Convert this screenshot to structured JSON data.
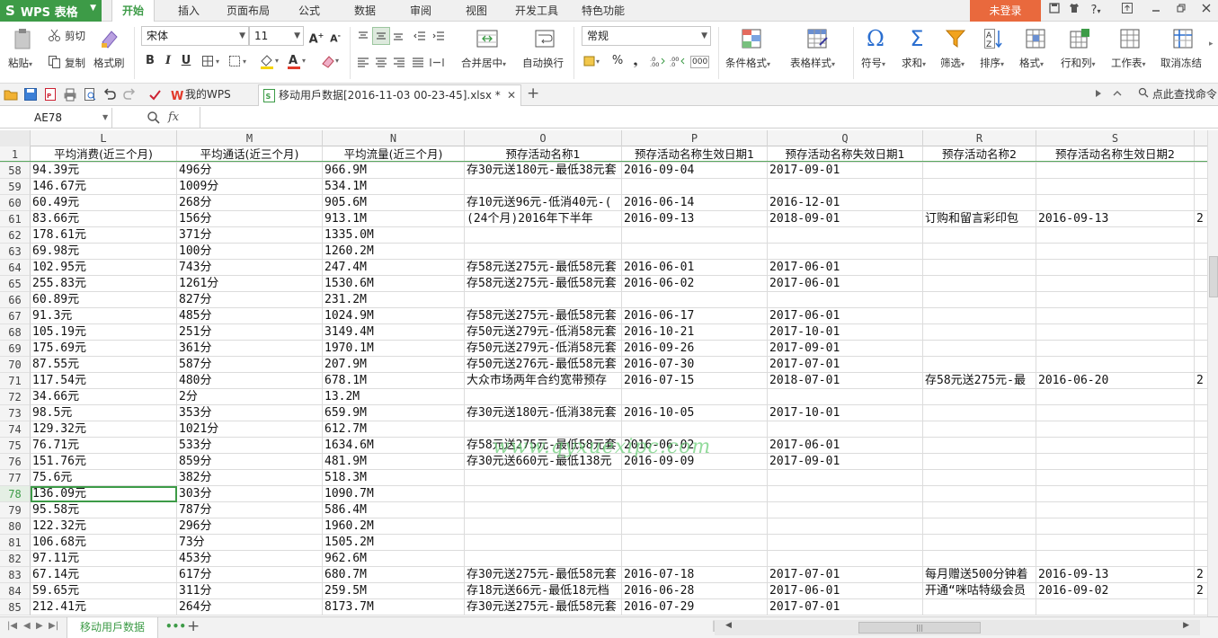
{
  "app": {
    "name": "WPS 表格",
    "login_label": "未登录",
    "help_label": "?"
  },
  "menu": {
    "tabs": [
      "开始",
      "插入",
      "页面布局",
      "公式",
      "数据",
      "审阅",
      "视图",
      "开发工具",
      "特色功能"
    ],
    "active": 0
  },
  "ribbon": {
    "paste": "粘贴",
    "cut": "剪切",
    "copy": "复制",
    "format_painter": "格式刷",
    "font_name": "宋体",
    "font_size": "11",
    "merge_center": "合并居中",
    "wrap_text": "自动换行",
    "number_format": "常规",
    "conditional_format": "条件格式",
    "table_style": "表格样式",
    "symbol": "符号",
    "sum": "求和",
    "filter": "筛选",
    "sort": "排序",
    "format": "格式",
    "rows_cols": "行和列",
    "worksheet": "工作表",
    "freeze": "取消冻结",
    "bold": "B",
    "italic": "I",
    "underline": "U",
    "percent": "%",
    "thousands": "000"
  },
  "tabs": {
    "my_wps": "我的WPS",
    "document": "移动用戶数据[2016-11-03 00-23-45].xlsx *",
    "find_command": "点此查找命令"
  },
  "formula_bar": {
    "name_box": "AE78",
    "fx": "fx",
    "content": ""
  },
  "grid": {
    "columns": [
      "L",
      "M",
      "N",
      "O",
      "P",
      "Q",
      "R",
      "S"
    ],
    "header_row_num": "1",
    "headers": [
      "平均消费(近三个月)",
      "平均通话(近三个月)",
      "平均流量(近三个月)",
      "预存活动名称1",
      "预存活动名称生效日期1",
      "预存活动名称失效日期1",
      "预存活动名称2",
      "预存活动名称生效日期2"
    ],
    "selected_row": "78",
    "overflow_char": "2",
    "rows": [
      {
        "n": "58",
        "L": "94.39元",
        "M": "496分",
        "N": "966.9M",
        "O": "存30元送180元-最低38元套",
        "P": "2016-09-04",
        "Q": "2017-09-01",
        "R": "",
        "S": "",
        "T": ""
      },
      {
        "n": "59",
        "L": "146.67元",
        "M": "1009分",
        "N": "534.1M",
        "O": "",
        "P": "",
        "Q": "",
        "R": "",
        "S": "",
        "T": ""
      },
      {
        "n": "60",
        "L": "60.49元",
        "M": "268分",
        "N": "905.6M",
        "O": "存10元送96元-低消40元-(",
        "P": "2016-06-14",
        "Q": "2016-12-01",
        "R": "",
        "S": "",
        "T": ""
      },
      {
        "n": "61",
        "L": "83.66元",
        "M": "156分",
        "N": "913.1M",
        "O": "(24个月)2016年下半年",
        "P": "2016-09-13",
        "Q": "2018-09-01",
        "R": "订购和留言彩印包",
        "S": "2016-09-13",
        "T": "2"
      },
      {
        "n": "62",
        "L": "178.61元",
        "M": "371分",
        "N": "1335.0M",
        "O": "",
        "P": "",
        "Q": "",
        "R": "",
        "S": "",
        "T": ""
      },
      {
        "n": "63",
        "L": "69.98元",
        "M": "100分",
        "N": "1260.2M",
        "O": "",
        "P": "",
        "Q": "",
        "R": "",
        "S": "",
        "T": ""
      },
      {
        "n": "64",
        "L": "102.95元",
        "M": "743分",
        "N": "247.4M",
        "O": "存58元送275元-最低58元套",
        "P": "2016-06-01",
        "Q": "2017-06-01",
        "R": "",
        "S": "",
        "T": ""
      },
      {
        "n": "65",
        "L": "255.83元",
        "M": "1261分",
        "N": "1530.6M",
        "O": "存58元送275元-最低58元套",
        "P": "2016-06-02",
        "Q": "2017-06-01",
        "R": "",
        "S": "",
        "T": ""
      },
      {
        "n": "66",
        "L": "60.89元",
        "M": "827分",
        "N": "231.2M",
        "O": "",
        "P": "",
        "Q": "",
        "R": "",
        "S": "",
        "T": ""
      },
      {
        "n": "67",
        "L": "91.3元",
        "M": "485分",
        "N": "1024.9M",
        "O": "存58元送275元-最低58元套",
        "P": "2016-06-17",
        "Q": "2017-06-01",
        "R": "",
        "S": "",
        "T": ""
      },
      {
        "n": "68",
        "L": "105.19元",
        "M": "251分",
        "N": "3149.4M",
        "O": "存50元送279元-低消58元套",
        "P": "2016-10-21",
        "Q": "2017-10-01",
        "R": "",
        "S": "",
        "T": ""
      },
      {
        "n": "69",
        "L": "175.69元",
        "M": "361分",
        "N": "1970.1M",
        "O": "存50元送279元-低消58元套",
        "P": "2016-09-26",
        "Q": "2017-09-01",
        "R": "",
        "S": "",
        "T": ""
      },
      {
        "n": "70",
        "L": "87.55元",
        "M": "587分",
        "N": "207.9M",
        "O": "存50元送276元-最低58元套",
        "P": "2016-07-30",
        "Q": "2017-07-01",
        "R": "",
        "S": "",
        "T": ""
      },
      {
        "n": "71",
        "L": "117.54元",
        "M": "480分",
        "N": "678.1M",
        "O": "大众市场两年合约宽带预存",
        "P": "2016-07-15",
        "Q": "2018-07-01",
        "R": "存58元送275元-最",
        "S": "2016-06-20",
        "T": "2"
      },
      {
        "n": "72",
        "L": "34.66元",
        "M": "2分",
        "N": "13.2M",
        "O": "",
        "P": "",
        "Q": "",
        "R": "",
        "S": "",
        "T": ""
      },
      {
        "n": "73",
        "L": "98.5元",
        "M": "353分",
        "N": "659.9M",
        "O": "存30元送180元-低消38元套",
        "P": "2016-10-05",
        "Q": "2017-10-01",
        "R": "",
        "S": "",
        "T": ""
      },
      {
        "n": "74",
        "L": "129.32元",
        "M": "1021分",
        "N": "612.7M",
        "O": "",
        "P": "",
        "Q": "",
        "R": "",
        "S": "",
        "T": ""
      },
      {
        "n": "75",
        "L": "76.71元",
        "M": "533分",
        "N": "1634.6M",
        "O": "存58元送275元-最低58元套",
        "P": "2016-06-02",
        "Q": "2017-06-01",
        "R": "",
        "S": "",
        "T": ""
      },
      {
        "n": "76",
        "L": "151.76元",
        "M": "859分",
        "N": "481.9M",
        "O": "存30元送660元-最低138元",
        "P": "2016-09-09",
        "Q": "2017-09-01",
        "R": "",
        "S": "",
        "T": ""
      },
      {
        "n": "77",
        "L": "75.6元",
        "M": "382分",
        "N": "518.3M",
        "O": "",
        "P": "",
        "Q": "",
        "R": "",
        "S": "",
        "T": ""
      },
      {
        "n": "78",
        "L": "136.09元",
        "M": "303分",
        "N": "1090.7M",
        "O": "",
        "P": "",
        "Q": "",
        "R": "",
        "S": "",
        "T": ""
      },
      {
        "n": "79",
        "L": "95.58元",
        "M": "787分",
        "N": "586.4M",
        "O": "",
        "P": "",
        "Q": "",
        "R": "",
        "S": "",
        "T": ""
      },
      {
        "n": "80",
        "L": "122.32元",
        "M": "296分",
        "N": "1960.2M",
        "O": "",
        "P": "",
        "Q": "",
        "R": "",
        "S": "",
        "T": ""
      },
      {
        "n": "81",
        "L": "106.68元",
        "M": "73分",
        "N": "1505.2M",
        "O": "",
        "P": "",
        "Q": "",
        "R": "",
        "S": "",
        "T": ""
      },
      {
        "n": "82",
        "L": "97.11元",
        "M": "453分",
        "N": "962.6M",
        "O": "",
        "P": "",
        "Q": "",
        "R": "",
        "S": "",
        "T": ""
      },
      {
        "n": "83",
        "L": "67.14元",
        "M": "617分",
        "N": "680.7M",
        "O": "存30元送275元-最低58元套",
        "P": "2016-07-18",
        "Q": "2017-07-01",
        "R": "每月赠送500分钟着",
        "S": "2016-09-13",
        "T": "2"
      },
      {
        "n": "84",
        "L": "59.65元",
        "M": "311分",
        "N": "259.5M",
        "O": "存18元送66元-最低18元档",
        "P": "2016-06-28",
        "Q": "2017-06-01",
        "R": "开通“咪咕特级会员",
        "S": "2016-09-02",
        "T": "2"
      },
      {
        "n": "85",
        "L": "212.41元",
        "M": "264分",
        "N": "8173.7M",
        "O": "存30元送275元-最低58元套",
        "P": "2016-07-29",
        "Q": "2017-07-01",
        "R": "",
        "S": "",
        "T": ""
      }
    ]
  },
  "watermark": "www.qyxuexipc.com",
  "sheet": {
    "active_sheet": "移动用戶数据",
    "more": "•••",
    "add": "+",
    "scroll_grip": "|||"
  }
}
